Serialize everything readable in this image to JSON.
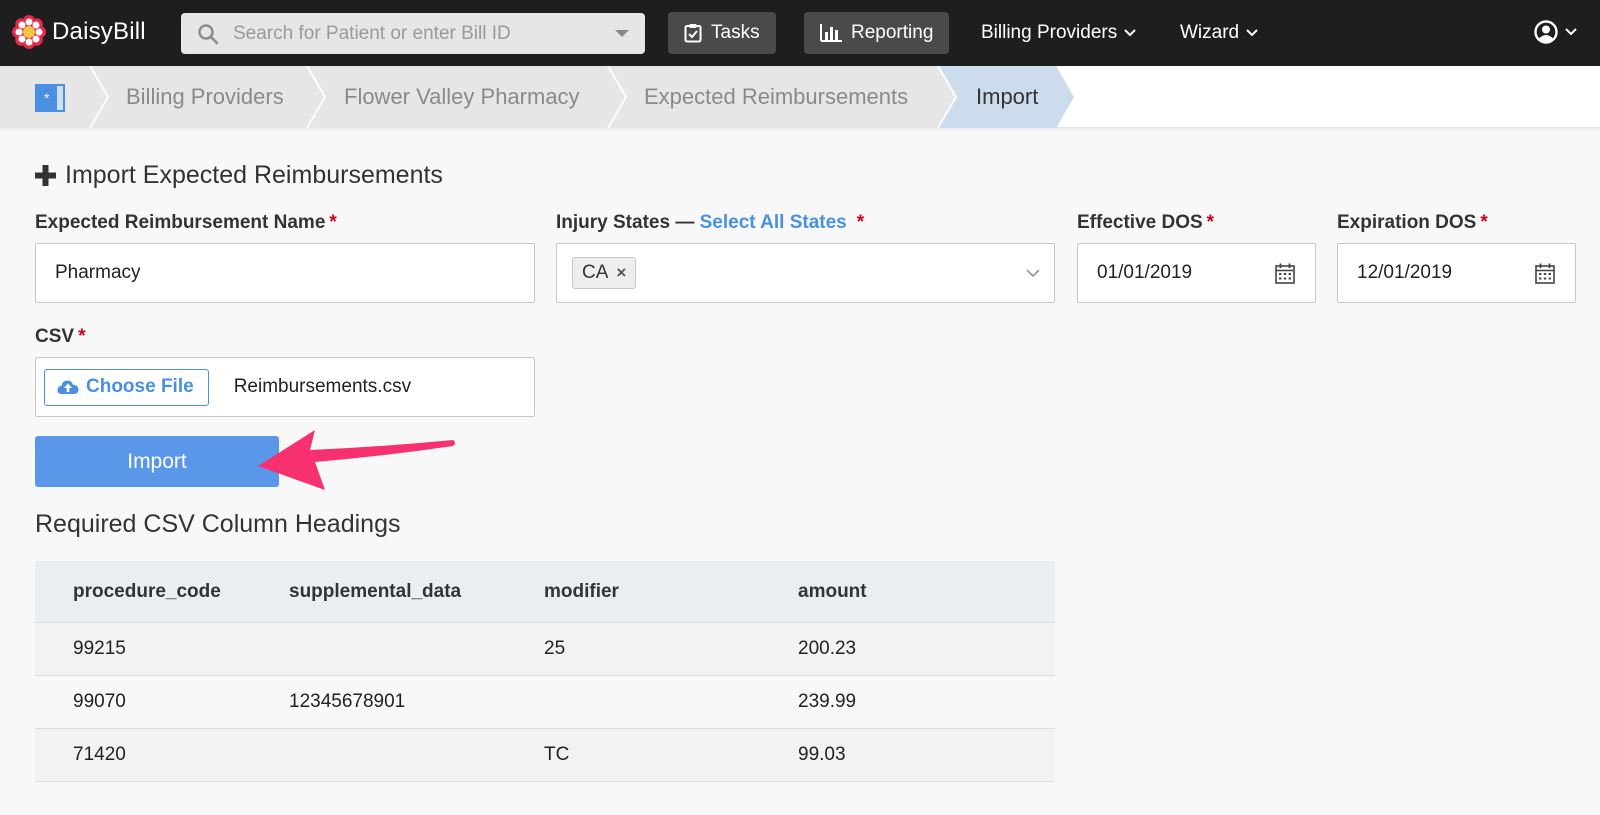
{
  "app": {
    "name": "DaisyBill"
  },
  "search": {
    "placeholder": "Search for Patient or enter Bill ID"
  },
  "nav": {
    "tasks": "Tasks",
    "reporting": "Reporting",
    "billing_providers": "Billing Providers",
    "wizard": "Wizard"
  },
  "breadcrumbs": [
    "Billing Providers",
    "Flower Valley Pharmacy",
    "Expected Reimbursements",
    "Import"
  ],
  "form": {
    "title": "Import Expected Reimbursements",
    "name_label": "Expected Reimbursement Name",
    "name_value": "Pharmacy",
    "states_label": "Injury States — ",
    "states_link": "Select All States",
    "states_selected": [
      "CA"
    ],
    "effective_label": "Effective DOS",
    "effective_value": "01/01/2019",
    "expiration_label": "Expiration DOS",
    "expiration_value": "12/01/2019",
    "csv_label": "CSV",
    "choose_file": "Choose File",
    "file_name": "Reimbursements.csv",
    "required_mark": "*",
    "import_button": "Import"
  },
  "csv_table": {
    "title": "Required CSV Column Headings",
    "headers": [
      "procedure_code",
      "supplemental_data",
      "modifier",
      "amount"
    ],
    "rows": [
      [
        "99215",
        "",
        "25",
        "200.23"
      ],
      [
        "99070",
        "12345678901",
        "",
        "239.99"
      ],
      [
        "71420",
        "",
        "TC",
        "99.03"
      ]
    ]
  },
  "colors": {
    "accent": "#4a90e2",
    "import_button": "#5b97e8",
    "required": "#d0021b",
    "annotation_arrow": "#f7306f",
    "topbar": "#1e1e1e"
  }
}
